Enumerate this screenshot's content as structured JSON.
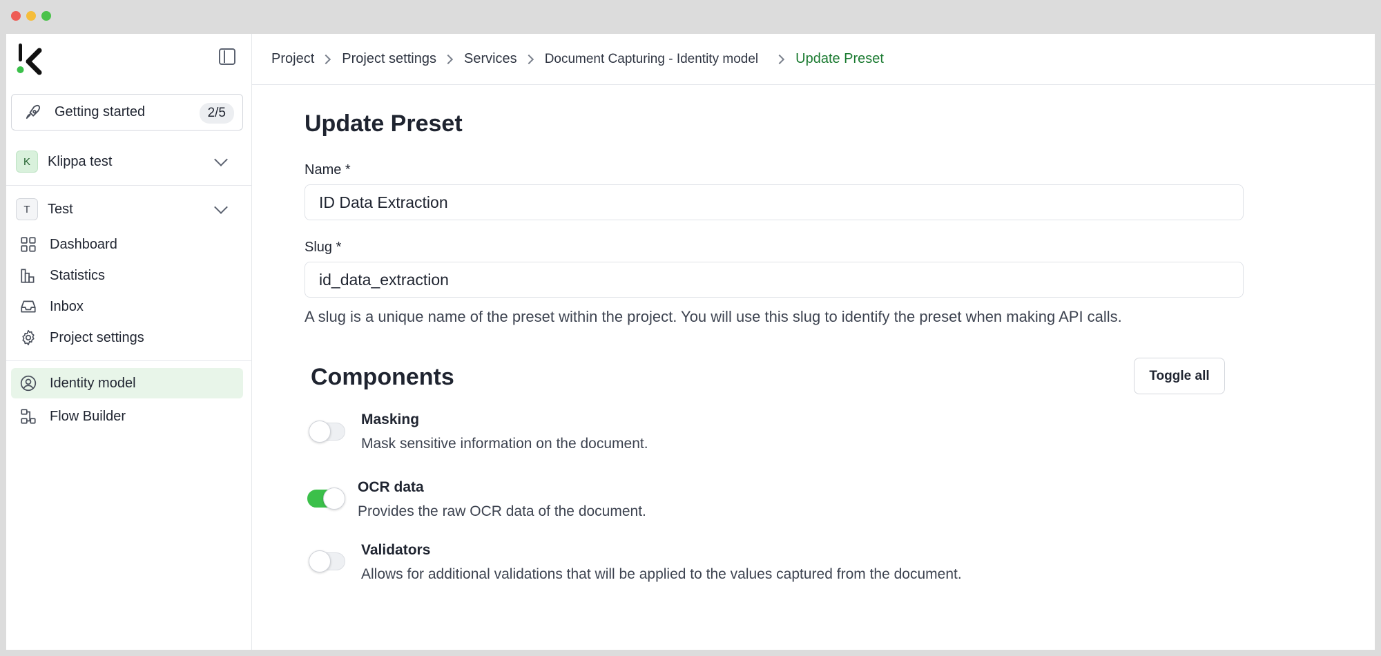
{
  "sidebar": {
    "getting_started": {
      "label": "Getting started",
      "progress": "2/5"
    },
    "workspace": {
      "initial": "K",
      "label": "Klippa test"
    },
    "project": {
      "initial": "T",
      "label": "Test"
    },
    "nav": [
      {
        "label": "Dashboard",
        "icon": "grid-icon"
      },
      {
        "label": "Statistics",
        "icon": "bar-chart-icon"
      },
      {
        "label": "Inbox",
        "icon": "inbox-icon"
      },
      {
        "label": "Project settings",
        "icon": "gear-icon"
      }
    ],
    "services": [
      {
        "label": "Identity model",
        "icon": "user-circle-icon",
        "active": true
      },
      {
        "label": "Flow Builder",
        "icon": "flow-icon",
        "active": false
      }
    ]
  },
  "breadcrumb": [
    "Project",
    "Project settings",
    "Services",
    "Document Capturing - Identity model",
    "Update Preset"
  ],
  "form": {
    "title": "Update Preset",
    "name_label": "Name *",
    "name_value": "ID Data Extraction",
    "slug_label": "Slug *",
    "slug_value": "id_data_extraction",
    "slug_help": "A slug is a unique name of the preset within the project. You will use this slug to identify the preset when making API calls."
  },
  "components": {
    "title": "Components",
    "toggle_all": "Toggle all",
    "items": [
      {
        "title": "Masking",
        "description": "Mask sensitive information on the document.",
        "enabled": false
      },
      {
        "title": "OCR data",
        "description": "Provides the raw OCR data of the document.",
        "enabled": true
      },
      {
        "title": "Validators",
        "description": "Allows for additional validations that will be applied to the values captured from the document.",
        "enabled": false
      }
    ]
  },
  "colors": {
    "accent": "#3bc04a",
    "breadcrumb_current": "#1a7a30",
    "active_nav_bg": "#e8f5e9"
  }
}
